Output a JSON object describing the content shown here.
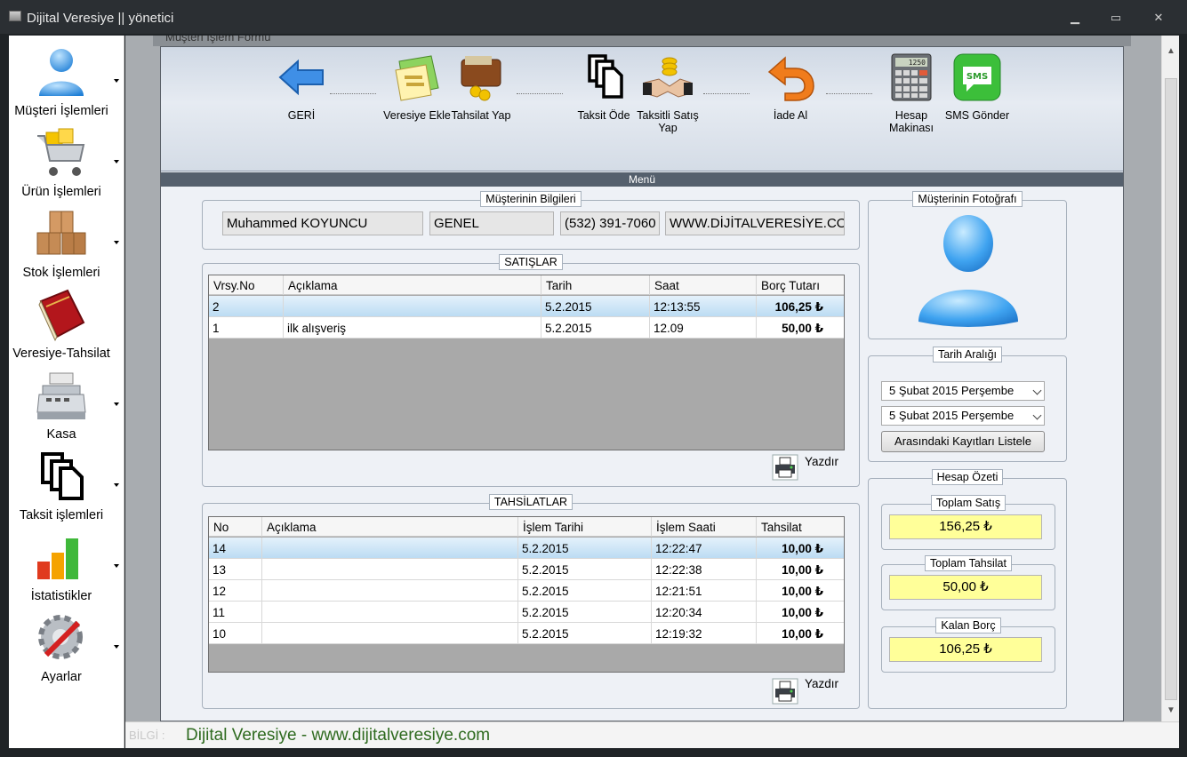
{
  "window": {
    "title": "Dijital Veresiye  ||  yönetici",
    "minimize": "▁",
    "maximize": "▭",
    "close": "✕"
  },
  "sidebar": {
    "items": [
      {
        "label": "Müşteri İşlemleri",
        "icon": "user-icon"
      },
      {
        "label": "Ürün İşlemleri",
        "icon": "cart-icon"
      },
      {
        "label": "Stok İşlemleri",
        "icon": "boxes-icon"
      },
      {
        "label": "Veresiye-Tahsilat",
        "icon": "book-icon"
      },
      {
        "label": "Kasa",
        "icon": "cash-register-icon"
      },
      {
        "label": "Taksit işlemleri",
        "icon": "installment-icon"
      },
      {
        "label": "İstatistikler",
        "icon": "bar-chart-icon"
      },
      {
        "label": "Ayarlar",
        "icon": "settings-icon"
      }
    ]
  },
  "child_window": {
    "title": "Müşteri İşlem Formu"
  },
  "toolbar": {
    "geri": "GERİ",
    "veresiye_ekle": "Veresiye Ekle",
    "tahsilat_yap": "Tahsilat Yap",
    "taksit_ode": "Taksit Öde",
    "taksitli_satis": "Taksitli Satış Yap",
    "iade_al": "İade Al",
    "hesap_makinasi": "Hesap Makinası",
    "sms_gonder": "SMS Gönder",
    "menu_label": "Menü",
    "calc_display": "1250"
  },
  "customer": {
    "group_title": "Müşterinin Bilgileri",
    "name": "Muhammed KOYUNCU",
    "group": "GENEL",
    "phone": "(532) 391-7060",
    "website": "WWW.DİJİTALVERESİYE.COM",
    "photo_title": "Müşterinin Fotoğrafı"
  },
  "sales": {
    "title": "SATIŞLAR",
    "columns": [
      "Vrsy.No",
      "Açıklama",
      "Tarih",
      "Saat",
      "Borç Tutarı"
    ],
    "rows": [
      [
        "2",
        "",
        "5.2.2015",
        "12:13:55",
        "106,25 ₺"
      ],
      [
        "1",
        "ilk alışveriş",
        "5.2.2015",
        "12.09",
        "50,00 ₺"
      ]
    ],
    "print_label": "Yazdır"
  },
  "payments": {
    "title": "TAHSİLATLAR",
    "columns": [
      "No",
      "Açıklama",
      "İşlem Tarihi",
      "İşlem Saati",
      "Tahsilat"
    ],
    "rows": [
      [
        "14",
        "",
        "5.2.2015",
        "12:22:47",
        "10,00 ₺"
      ],
      [
        "13",
        "",
        "5.2.2015",
        "12:22:38",
        "10,00 ₺"
      ],
      [
        "12",
        "",
        "5.2.2015",
        "12:21:51",
        "10,00 ₺"
      ],
      [
        "11",
        "",
        "5.2.2015",
        "12:20:34",
        "10,00 ₺"
      ],
      [
        "10",
        "",
        "5.2.2015",
        "12:19:32",
        "10,00 ₺"
      ]
    ],
    "print_label": "Yazdır"
  },
  "date_range": {
    "title": "Tarih Aralığı",
    "start": "5   Şubat   2015 Perşembe",
    "end": "5   Şubat   2015 Perşembe",
    "list_button": "Arasındaki Kayıtları Listele"
  },
  "summary": {
    "title": "Hesap Özeti",
    "total_sales_label": "Toplam Satış",
    "total_sales": "156,25 ₺",
    "total_payments_label": "Toplam Tahsilat",
    "total_payments": "50,00 ₺",
    "remaining_label": "Kalan Borç",
    "remaining": "106,25 ₺"
  },
  "statusbar": {
    "bilgi": "BİLGİ :",
    "text": "Dijital Veresiye - www.dijitalveresiye.com"
  },
  "colors": {
    "accent_blue": "#2f8fe0",
    "highlight_yellow": "#ffff99",
    "status_green": "#2e6a1f"
  }
}
